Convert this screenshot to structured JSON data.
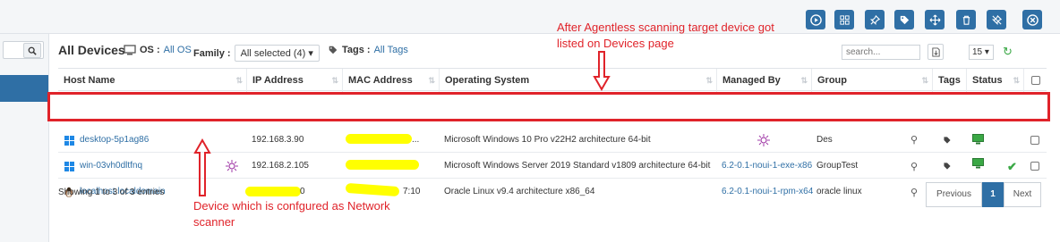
{
  "topbar": {
    "buttons": [
      {
        "name": "play-icon"
      },
      {
        "name": "grid-icon"
      },
      {
        "name": "pin-icon"
      },
      {
        "name": "tag-icon"
      },
      {
        "name": "move-icon"
      },
      {
        "name": "trash-icon"
      },
      {
        "name": "no-pin-icon"
      },
      {
        "name": "close-icon"
      }
    ]
  },
  "main": {
    "title": "All Devices",
    "os_label": "OS :",
    "os_value": "All OS",
    "family_label": "Family :",
    "family_value": "All selected (4)",
    "tags_label": "Tags :",
    "tags_value": "All Tags",
    "search_placeholder": "search...",
    "page_size": "15"
  },
  "table": {
    "columns": [
      "Host Name",
      "IP Address",
      "MAC Address",
      "Operating System",
      "Managed By",
      "Group",
      "Tags",
      "Status"
    ],
    "rows": [
      {
        "host": "desktop-5p1ag86",
        "ip": "192.168.3.90",
        "mac_suffix": "...",
        "os": "Microsoft Windows 10 Pro v22H2 architecture 64-bit",
        "managed_by": "",
        "group": "Des"
      },
      {
        "host": "win-03vh0dltfnq",
        "ip": "192.168.2.105",
        "mac_suffix": "",
        "os": "Microsoft Windows Server 2019 Standard v1809 architecture 64-bit",
        "managed_by": "6.2-0.1-noui-1-exe-x86",
        "group": "GroupTest"
      },
      {
        "host": "localhost.localdomain",
        "ip": "0",
        "mac_suffix": "7:10",
        "os": "Oracle Linux v9.4 architecture x86_64",
        "managed_by": "6.2-0.1-noui-1-rpm-x64",
        "group": "oracle linux"
      }
    ]
  },
  "footer": {
    "showing": "Showing 1 to 3 of 3 entries",
    "previous": "Previous",
    "current_page": "1",
    "next": "Next"
  },
  "annotations": {
    "top_line1": "After Agentless scanning target device got",
    "top_line2": "listed on Devices page",
    "bottom_line1": "Device which is confgured as Network",
    "bottom_line2": "scanner"
  },
  "colors": {
    "accent": "#2f6fa5",
    "annotation": "#e0232a",
    "redaction": "#ffff00",
    "status_ok": "#3aa845"
  }
}
